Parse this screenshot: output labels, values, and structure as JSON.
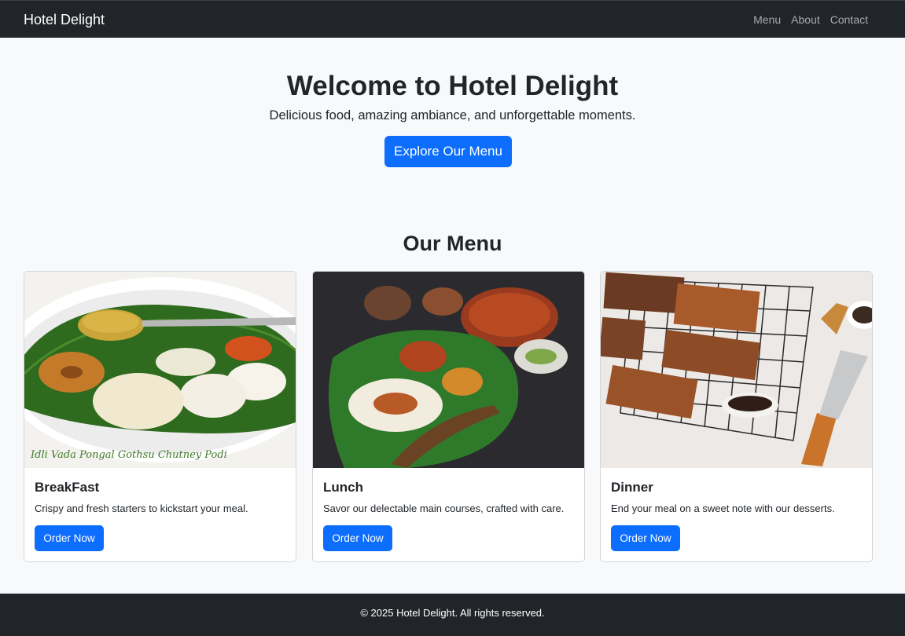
{
  "navbar": {
    "brand": "Hotel Delight",
    "links": [
      "Menu",
      "About",
      "Contact"
    ]
  },
  "hero": {
    "title": "Welcome to Hotel Delight",
    "subtitle": "Delicious food, amazing ambiance, and unforgettable moments.",
    "button_label": "Explore Our Menu"
  },
  "menu": {
    "title": "Our Menu",
    "cards": [
      {
        "title": "BreakFast",
        "text": "Crispy and fresh starters to kickstart your meal.",
        "button_label": "Order Now",
        "image_caption": "Idli Vada Pongal Gothsu Chutney Podi"
      },
      {
        "title": "Lunch",
        "text": "Savor our delectable main courses, crafted with care.",
        "button_label": "Order Now"
      },
      {
        "title": "Dinner",
        "text": "End your meal on a sweet note with our desserts.",
        "button_label": "Order Now"
      }
    ]
  },
  "footer": {
    "text": "© 2025 Hotel Delight. All rights reserved."
  },
  "colors": {
    "navbar": "#212529",
    "primary": "#0d6efd",
    "background": "#f8f9fa"
  }
}
